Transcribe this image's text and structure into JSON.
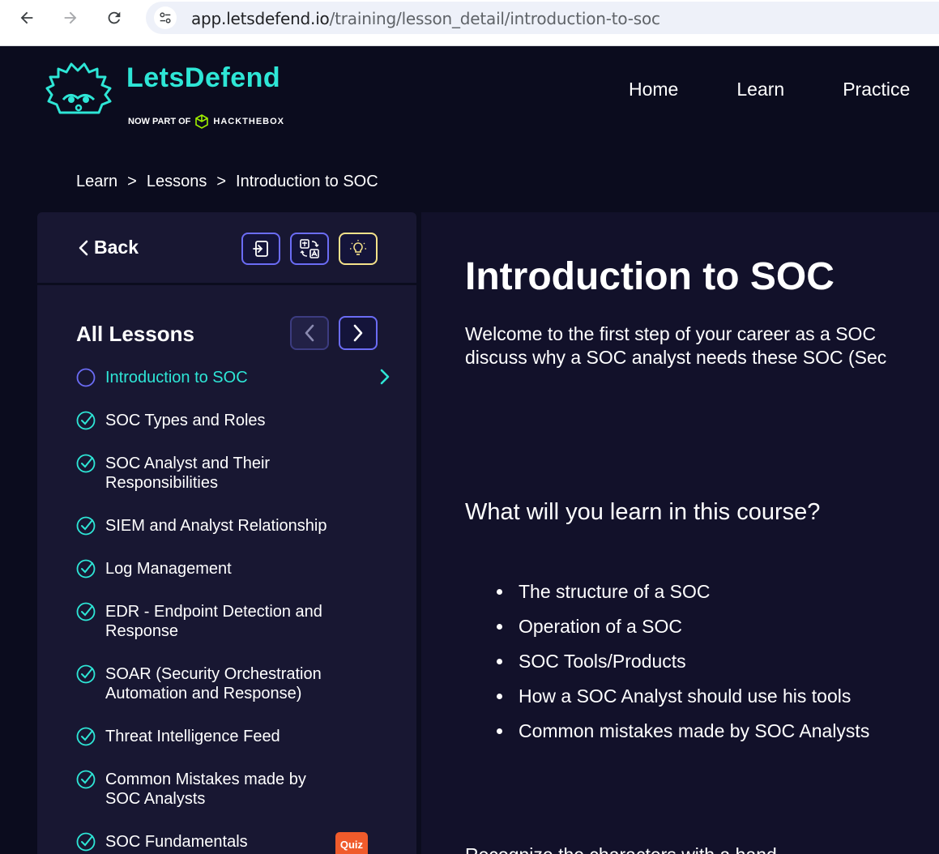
{
  "browser": {
    "url_host": "app.letsdefend.io",
    "url_path": "/training/lesson_detail/introduction-to-soc"
  },
  "header": {
    "brand": "LetsDefend",
    "tagline_prefix": "NOW PART OF",
    "tagline_brand": "HACKTHEBOX",
    "nav": [
      "Home",
      "Learn",
      "Practice"
    ]
  },
  "breadcrumb": {
    "items": [
      "Learn",
      "Lessons",
      "Introduction to SOC"
    ],
    "separator": ">"
  },
  "sidebar": {
    "back_label": "Back",
    "lessons_title": "All Lessons",
    "lessons": [
      {
        "label": "Introduction to SOC",
        "status": "current"
      },
      {
        "label": "SOC Types and Roles",
        "status": "done"
      },
      {
        "label": "SOC Analyst and Their Responsibilities",
        "status": "done"
      },
      {
        "label": "SIEM and Analyst Relationship",
        "status": "done"
      },
      {
        "label": "Log Management",
        "status": "done"
      },
      {
        "label": "EDR - Endpoint Detection and Response",
        "status": "done"
      },
      {
        "label": "SOAR (Security Orchestration Automation and Response)",
        "status": "done"
      },
      {
        "label": "Threat Intelligence Feed",
        "status": "done"
      },
      {
        "label": "Common Mistakes made by SOC Analysts",
        "status": "done"
      },
      {
        "label": "SOC Fundamentals",
        "status": "done",
        "badge": "Quiz"
      }
    ]
  },
  "main": {
    "title": "Introduction to SOC",
    "intro_line1": "Welcome to the first step of your career as a SOC",
    "intro_line2": "discuss why a SOC analyst needs these SOC (Sec",
    "section_heading": "What will you learn in this course?",
    "bullets": [
      "The structure of a SOC",
      "Operation of a SOC",
      "SOC Tools/Products",
      "How a SOC Analyst should use his tools",
      "Common mistakes made by SOC Analysts"
    ],
    "trailing_text": "Recognize the characters with a hand"
  },
  "colors": {
    "accent": "#2ee6d6",
    "background": "#0b0c1e",
    "panel": "#181732",
    "button_border": "#6b6cf5",
    "quiz_badge": "#f05b2b"
  }
}
